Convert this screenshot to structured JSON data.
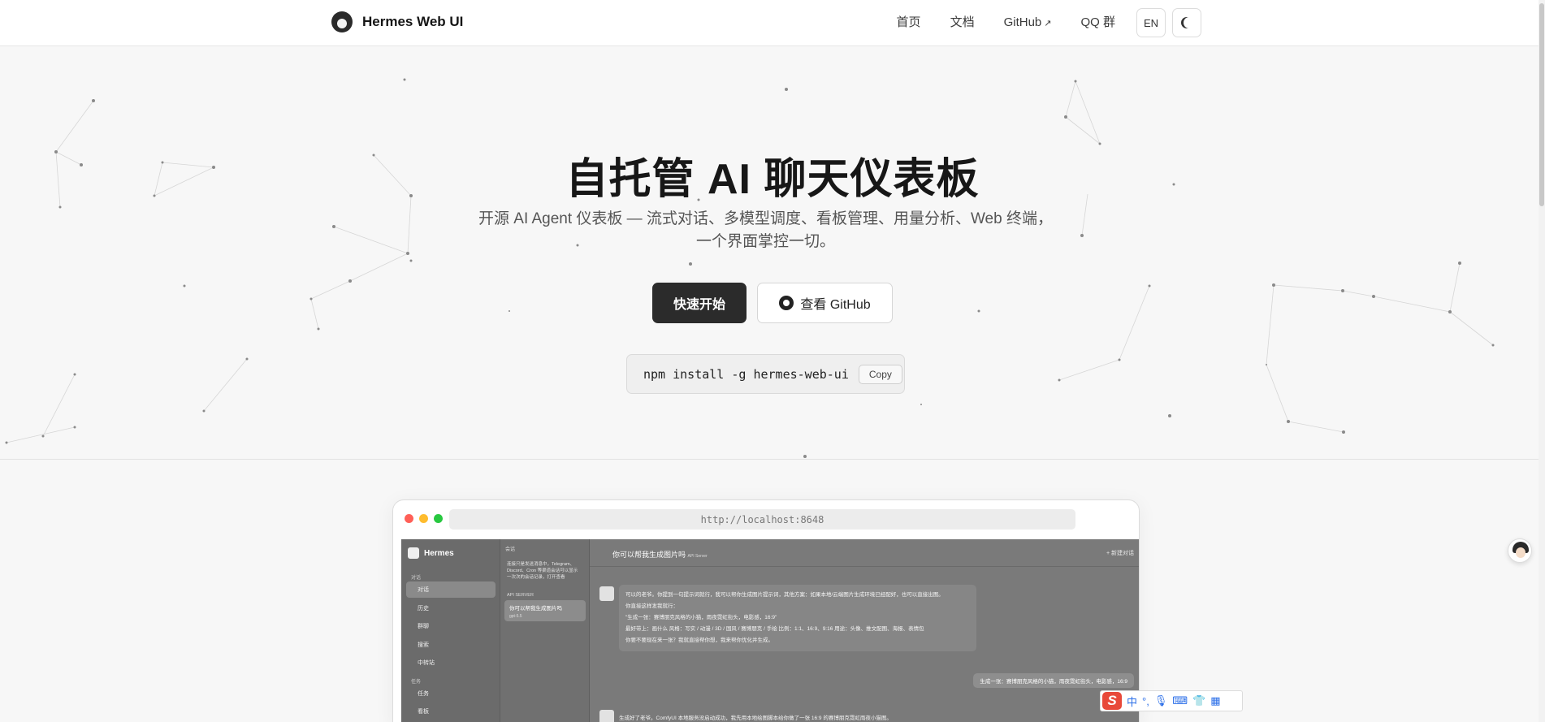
{
  "header": {
    "brand": "Hermes Web UI",
    "nav": [
      {
        "label": "首页"
      },
      {
        "label": "文档"
      },
      {
        "label": "GitHub",
        "external": true
      },
      {
        "label": "QQ 群"
      }
    ],
    "lang_button": "EN",
    "theme_toggle_icon": "moon-icon"
  },
  "hero": {
    "title": "自托管 AI 聊天仪表板",
    "subtitle": "开源 AI Agent 仪表板 — 流式对话、多模型调度、看板管理、用量分析、Web 终端，一个界面掌控一切。",
    "primary_cta": "快速开始",
    "secondary_cta": "查看 GitHub",
    "install_command": "npm install -g hermes-web-ui",
    "copy_label": "Copy"
  },
  "preview": {
    "url": "http://localhost:8648",
    "dot_colors": [
      "#ff5f57",
      "#febc2e",
      "#28c840"
    ],
    "app": {
      "name": "Hermes",
      "group_chat": "对话",
      "sidebar": [
        {
          "label": "对话",
          "active": true
        },
        {
          "label": "历史"
        },
        {
          "label": "群聊"
        },
        {
          "label": "搜索"
        },
        {
          "label": "中转站"
        }
      ],
      "group_tasks": "任务",
      "sidebar2": [
        {
          "label": "任务"
        },
        {
          "label": "看板"
        }
      ],
      "list_header": "会话",
      "list_note": "连接只是发送消息中，Telegram、Discord、Cron 等渠道会话可以显示一次次的会话记录，打开查看",
      "list_group": "API SERVER",
      "list_item_title": "你可以帮我生成图片吗",
      "list_item_meta": "gpt-5.5",
      "chat_title": "你可以帮我生成图片吗",
      "chat_subtitle": "API Server",
      "new_chat": "+ 新建对话",
      "assistant_lines": [
        "可以的老爷。你提到一句提示词就行，我可以帮你生成图片提示词，其他方案：如果本地/云端图片生成环境已经配好，也可以直接出图。",
        "你直接这样发我就行：",
        "\"生成一张：赛博朋克风格的小猫，雨夜霓虹街头，电影感，16:9\"",
        "最好带上：画什么 风格：写实 / 动漫 / 3D / 国风 / 赛博朋克 / 手绘 比例：1:1、16:9、9:16 用途：头像、推文配图、海报、表情包",
        "你要不要现在来一张？我就直接帮你想，我来帮你优化并生成。"
      ],
      "user_message": "生成一张：赛博朋克风格的小猫，雨夜霓虹街头，电影感，16:9",
      "assistant_reply": "生成好了老爷。ComfyUI 本地服务没启动成功，我先用本地绘图脚本给你做了一张 16:9 的赛博朋克霓虹雨夜小猫图。"
    }
  },
  "ime": {
    "logo": "S",
    "mode": "中",
    "icons": [
      "punctuation-icon",
      "microphone-icon",
      "keyboard-icon",
      "skin-icon",
      "apps-icon"
    ]
  }
}
